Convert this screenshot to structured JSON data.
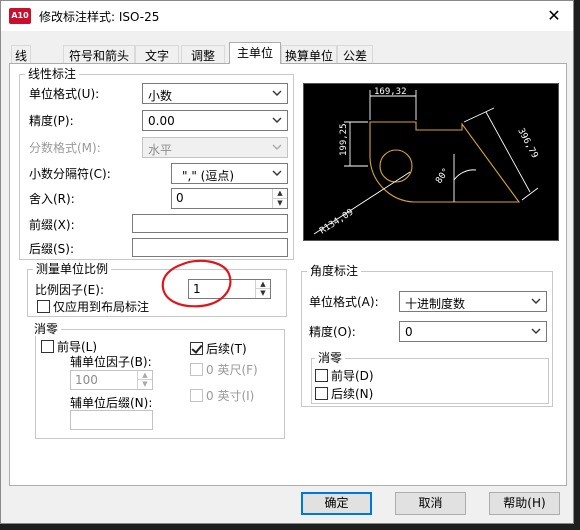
{
  "window": {
    "title": "修改标注样式: ISO-25",
    "app_icon_text": "A10"
  },
  "tabs": [
    {
      "label": "线"
    },
    {
      "label": "符号和箭头"
    },
    {
      "label": "文字"
    },
    {
      "label": "调整"
    },
    {
      "label": "主单位"
    },
    {
      "label": "换算单位"
    },
    {
      "label": "公差"
    }
  ],
  "active_tab": "主单位",
  "linear": {
    "group_title": "线性标注",
    "unit_format": {
      "label": "单位格式(U):",
      "value": "小数"
    },
    "precision": {
      "label": "精度(P):",
      "value": "0.00"
    },
    "fraction_format": {
      "label": "分数格式(M):",
      "value": "水平"
    },
    "decimal_separator": {
      "label": "小数分隔符(C):",
      "value": "\",\" (逗点)"
    },
    "round_off": {
      "label": "舍入(R):",
      "value": "0"
    },
    "prefix": {
      "label": "前缀(X):",
      "value": ""
    },
    "suffix": {
      "label": "后缀(S):",
      "value": ""
    }
  },
  "scale": {
    "group_title": "测量单位比例",
    "factor": {
      "label": "比例因子(E):",
      "value": "1"
    },
    "layout_only": {
      "label": "仅应用到布局标注",
      "checked": false
    }
  },
  "zero_suppression": {
    "group_title": "消零",
    "leading": {
      "label": "前导(L)",
      "checked": false
    },
    "trailing": {
      "label": "后续(T)",
      "checked": true
    },
    "sub_unit_factor": {
      "label": "辅单位因子(B):",
      "value": "100"
    },
    "sub_unit_suffix": {
      "label": "辅单位后缀(N):",
      "value": ""
    },
    "feet": {
      "label": "0 英尺(F)",
      "checked": false
    },
    "inches": {
      "label": "0 英寸(I)",
      "checked": false
    }
  },
  "preview": {
    "dim_top": "169,32",
    "dim_left": "199,25",
    "dim_right": "396,79",
    "dim_angle": "80°",
    "dim_radius": "R134,09"
  },
  "angular": {
    "group_title": "角度标注",
    "unit_format": {
      "label": "单位格式(A):",
      "value": "十进制度数"
    },
    "precision": {
      "label": "精度(O):",
      "value": "0"
    },
    "zero_title": "消零",
    "leading": {
      "label": "前导(D)",
      "checked": false
    },
    "trailing": {
      "label": "后续(N)",
      "checked": false
    }
  },
  "buttons": {
    "ok": "确定",
    "cancel": "取消",
    "help": "帮助(H)"
  },
  "colors": {
    "annotation_red": "#e0151b",
    "preview_yellow": "#d6a62c",
    "focus_blue": "#0078d7"
  }
}
